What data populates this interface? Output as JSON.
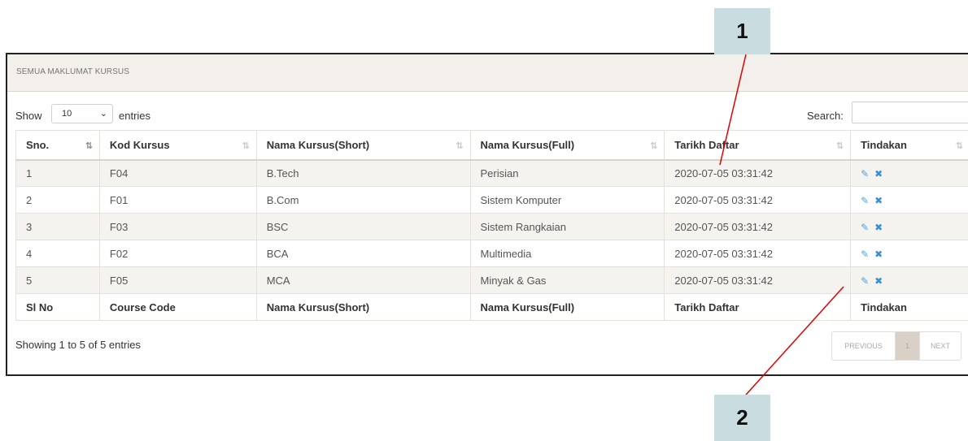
{
  "panel": {
    "title": "SEMUA MAKLUMAT KURSUS"
  },
  "controls": {
    "show_label": "Show",
    "length_value": "10",
    "entries_label": "entries",
    "search_label": "Search:",
    "search_value": ""
  },
  "table": {
    "headers": [
      "Sno.",
      "Kod Kursus",
      "Nama Kursus(Short)",
      "Nama Kursus(Full)",
      "Tarikh Daftar",
      "Tindakan"
    ],
    "rows": [
      {
        "sno": "1",
        "kod": "F04",
        "short": "B.Tech",
        "full": "Perisian",
        "tarikh": "2020-07-05 03:31:42"
      },
      {
        "sno": "2",
        "kod": "F01",
        "short": "B.Com",
        "full": "Sistem Komputer",
        "tarikh": "2020-07-05 03:31:42"
      },
      {
        "sno": "3",
        "kod": "F03",
        "short": "BSC",
        "full": "Sistem Rangkaian",
        "tarikh": "2020-07-05 03:31:42"
      },
      {
        "sno": "4",
        "kod": "F02",
        "short": "BCA",
        "full": "Multimedia",
        "tarikh": "2020-07-05 03:31:42"
      },
      {
        "sno": "5",
        "kod": "F05",
        "short": "MCA",
        "full": "Minyak & Gas",
        "tarikh": "2020-07-05 03:31:42"
      }
    ],
    "footers": [
      "Sl No",
      "Course Code",
      "Nama Kursus(Short)",
      "Nama Kursus(Full)",
      "Tarikh Daftar",
      "Tindakan"
    ],
    "actions": {
      "edit_icon": "edit-icon",
      "delete_icon": "close-icon"
    }
  },
  "info_text": "Showing 1 to 5 of 5 entries",
  "pagination": {
    "previous": "PREVIOUS",
    "current": "1",
    "next": "NEXT"
  },
  "callouts": {
    "one": "1",
    "two": "2"
  },
  "colors": {
    "callout_bg": "#c9dce0",
    "header_bg": "#f3efea",
    "action_icon": "#4aa3df",
    "annotation_line": "#e00000"
  }
}
